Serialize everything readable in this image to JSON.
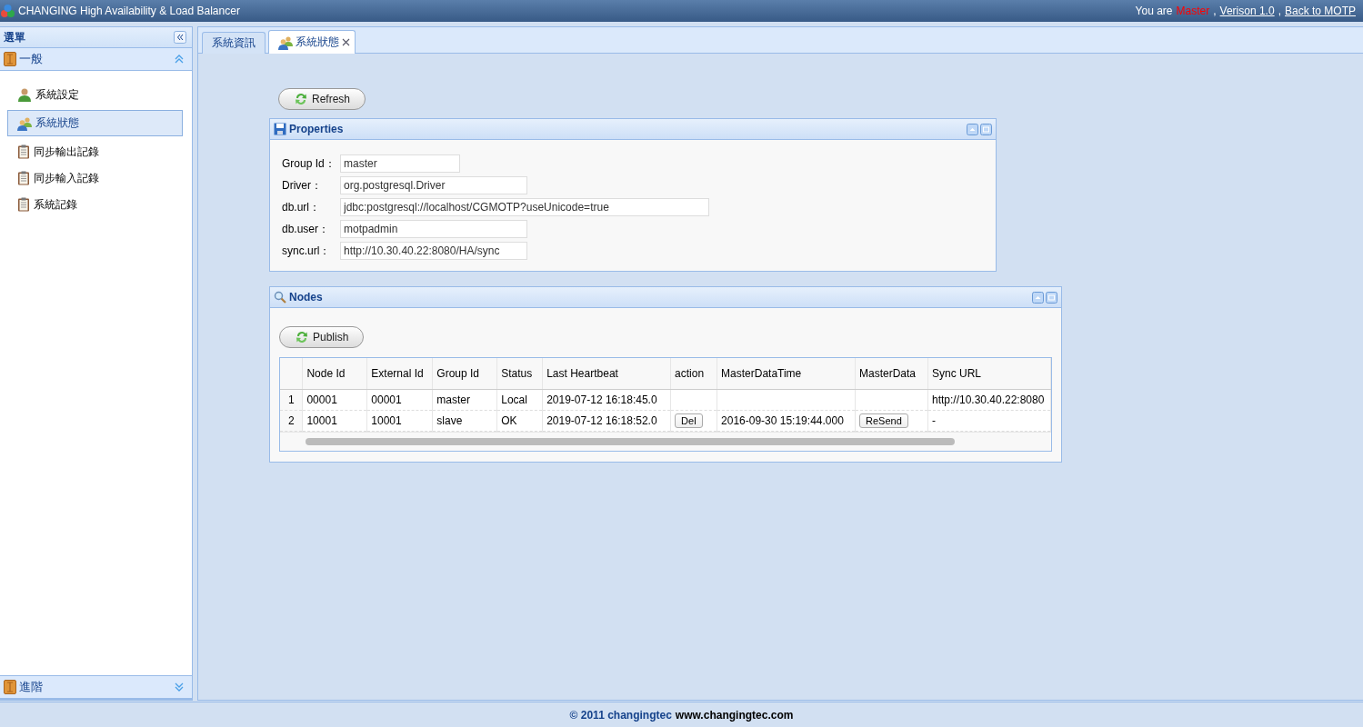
{
  "header": {
    "title": "CHANGING High Availability & Load Balancer",
    "status": [
      {
        "kind": "text",
        "text": "You are"
      },
      {
        "kind": "role",
        "text": "Master"
      },
      {
        "kind": "text",
        "text": ","
      },
      {
        "kind": "link",
        "text": "Verison 1.0"
      },
      {
        "kind": "text",
        "text": ","
      },
      {
        "kind": "link",
        "text": "Back to MOTP"
      }
    ]
  },
  "sidebar": {
    "title": "選單",
    "sections": [
      {
        "label": "一般",
        "expanded": true,
        "items": [
          {
            "label": "系統設定",
            "kind": "user",
            "selected": false
          },
          {
            "label": "系統狀態",
            "kind": "group",
            "selected": true
          },
          {
            "label": "同步輸出記錄",
            "kind": "log",
            "selected": false
          },
          {
            "label": "同步輸入記錄",
            "kind": "log",
            "selected": false
          },
          {
            "label": "系統記錄",
            "kind": "log",
            "selected": false
          }
        ]
      },
      {
        "label": "進階",
        "expanded": false
      }
    ]
  },
  "tabs": [
    {
      "label": "系統資訊",
      "selected": false,
      "closable": false
    },
    {
      "label": "系統狀態",
      "selected": true,
      "closable": true
    }
  ],
  "refresh_button": "Refresh",
  "properties": {
    "title": "Properties",
    "fields": [
      {
        "label": "Group Id：",
        "value": "master"
      },
      {
        "label": "Driver：",
        "value": "org.postgresql.Driver"
      },
      {
        "label": "db.url：",
        "value": "jdbc:postgresql://localhost/CGMOTP?useUnicode=true"
      },
      {
        "label": "db.user：",
        "value": "motpadmin"
      },
      {
        "label": "sync.url：",
        "value": "http://10.30.40.22:8080/HA/sync"
      }
    ]
  },
  "nodes": {
    "title": "Nodes",
    "publish_button": "Publish",
    "columns": [
      "Node Id",
      "External Id",
      "Group Id",
      "Status",
      "Last Heartbeat",
      "action",
      "MasterDataTime",
      "MasterData",
      "Sync URL"
    ],
    "rows": [
      {
        "number": "1",
        "cells": [
          {
            "kind": "text",
            "text": "00001"
          },
          {
            "kind": "text",
            "text": "00001"
          },
          {
            "kind": "text",
            "text": "master"
          },
          {
            "kind": "text",
            "text": "Local"
          },
          {
            "kind": "text",
            "text": "2019-07-12 16:18:45.0"
          },
          {
            "kind": "empty"
          },
          {
            "kind": "empty"
          },
          {
            "kind": "empty"
          },
          {
            "kind": "text",
            "text": "http://10.30.40.22:8080"
          }
        ]
      },
      {
        "number": "2",
        "cells": [
          {
            "kind": "text",
            "text": "10001"
          },
          {
            "kind": "text",
            "text": "10001"
          },
          {
            "kind": "text",
            "text": "slave"
          },
          {
            "kind": "text",
            "text": "OK"
          },
          {
            "kind": "text",
            "text": "2019-07-12 16:18:52.0"
          },
          {
            "kind": "button",
            "text": "Del"
          },
          {
            "kind": "text",
            "text": "2016-09-30 15:19:44.000"
          },
          {
            "kind": "button",
            "text": "ReSend"
          },
          {
            "kind": "text",
            "text": "-"
          }
        ]
      }
    ]
  },
  "footer": {
    "copyright": "© 2011 changingtec",
    "site": "www.changingtec.com"
  }
}
